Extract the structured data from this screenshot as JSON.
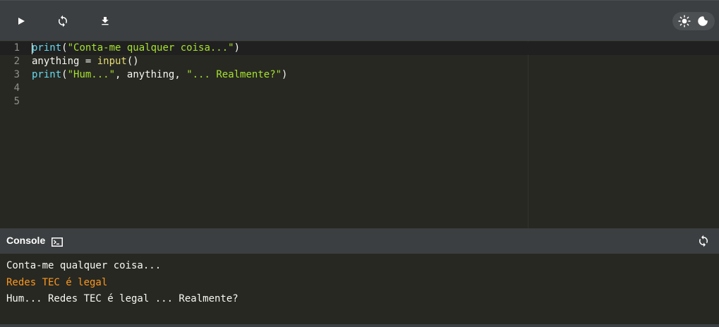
{
  "toolbar": {
    "run_icon": "play-icon",
    "reset_icon": "refresh-icon",
    "download_icon": "download-icon",
    "theme_light_icon": "sun-icon",
    "theme_dark_icon": "moon-icon"
  },
  "editor": {
    "lines": [
      {
        "num": "1",
        "tokens": [
          {
            "t": "print",
            "c": "k-fn"
          },
          {
            "t": "(",
            "c": "k-txt"
          },
          {
            "t": "\"Conta-me qualquer coisa...\"",
            "c": "k-str"
          },
          {
            "t": ")",
            "c": "k-txt"
          }
        ]
      },
      {
        "num": "2",
        "tokens": [
          {
            "t": "anything = ",
            "c": "k-txt"
          },
          {
            "t": "input",
            "c": "k-call"
          },
          {
            "t": "()",
            "c": "k-txt"
          }
        ]
      },
      {
        "num": "3",
        "tokens": [
          {
            "t": "print",
            "c": "k-fn"
          },
          {
            "t": "(",
            "c": "k-txt"
          },
          {
            "t": "\"Hum...\"",
            "c": "k-str"
          },
          {
            "t": ", anything, ",
            "c": "k-txt"
          },
          {
            "t": "\"... Realmente?\"",
            "c": "k-str"
          },
          {
            "t": ")",
            "c": "k-txt"
          }
        ]
      },
      {
        "num": "4",
        "tokens": []
      },
      {
        "num": "5",
        "tokens": []
      }
    ]
  },
  "console": {
    "title": "Console",
    "icon": "terminal-icon",
    "clear_icon": "refresh-icon",
    "output": [
      {
        "text": "Conta-me qualquer coisa...",
        "kind": "output"
      },
      {
        "text": "Redes TEC é legal",
        "kind": "input"
      },
      {
        "text": "Hum... Redes TEC é legal ... Realmente?",
        "kind": "output"
      }
    ]
  },
  "colors": {
    "toolbar_bg": "#3c3f41",
    "editor_bg": "#272822",
    "keyword": "#66d9ef",
    "string": "#a6e22e",
    "builtin_call": "#e6db74",
    "user_input": "#fd971f"
  }
}
